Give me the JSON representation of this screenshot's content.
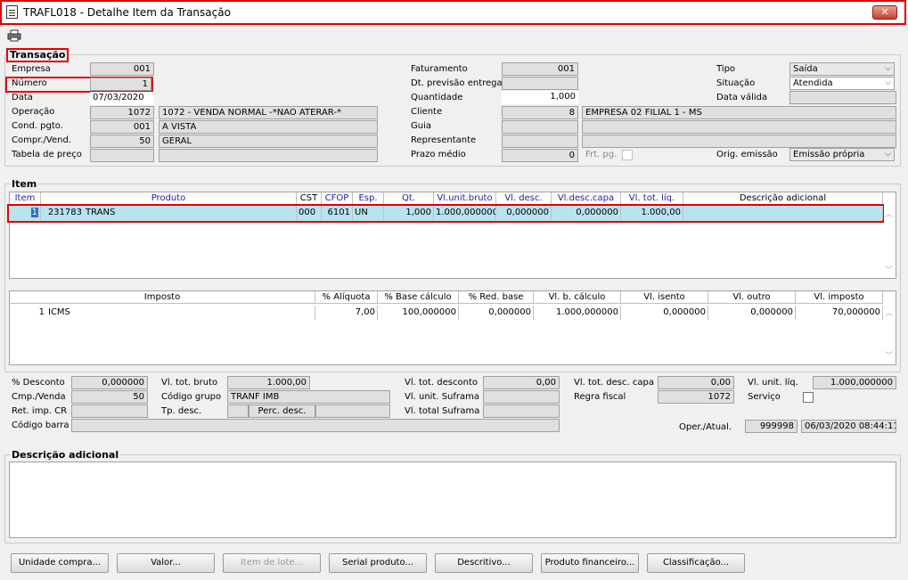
{
  "window": {
    "title": "TRAFL018 - Detalhe Item da Transação",
    "close": "✕"
  },
  "transacao": {
    "title": "Transação",
    "empresa": {
      "label": "Empresa",
      "value": "001"
    },
    "numero": {
      "label": "Número",
      "value": "1"
    },
    "data": {
      "label": "Data",
      "value": "07/03/2020"
    },
    "operacao": {
      "label": "Operação",
      "code": "1072",
      "desc": "1072 - VENDA NORMAL -*NAO ATERAR-*"
    },
    "cond_pgto": {
      "label": "Cond. pgto.",
      "code": "001",
      "desc": "A VISTA"
    },
    "compr_vend": {
      "label": "Compr./Vend.",
      "code": "50",
      "desc": "GERAL"
    },
    "tabela_preco": {
      "label": "Tabela de preço",
      "code": "",
      "desc": ""
    },
    "faturamento": {
      "label": "Faturamento",
      "value": "001"
    },
    "dt_previsao": {
      "label": "Dt. previsão entrega",
      "value": ""
    },
    "quantidade": {
      "label": "Quantidade",
      "value": "1,000"
    },
    "cliente": {
      "label": "Cliente",
      "code": "8",
      "desc": "EMPRESA 02 FILIAL 1 - MS"
    },
    "guia": {
      "label": "Guia",
      "value": ""
    },
    "representante": {
      "label": "Representante",
      "value": ""
    },
    "prazo_medio": {
      "label": "Prazo médio",
      "value": "0"
    },
    "frt_pg": {
      "label": "Frt. pg."
    },
    "tipo": {
      "label": "Tipo",
      "value": "Saída"
    },
    "situacao": {
      "label": "Situação",
      "value": "Atendida"
    },
    "data_valida": {
      "label": "Data válida",
      "value": ""
    },
    "orig_emissao": {
      "label": "Orig. emissão",
      "value": "Emissão própria"
    }
  },
  "item": {
    "title": "Item",
    "headers": [
      "Item",
      "Produto",
      "CST",
      "CFOP",
      "Esp.",
      "Qt.",
      "Vl.unit.bruto",
      "Vl. desc.",
      "Vl.desc.capa",
      "Vl. tot. líq.",
      "Descrição adicional"
    ],
    "rows": [
      {
        "item": "1",
        "code": "231783",
        "produto": "TRANS",
        "cst": "000",
        "cfop": "6101",
        "esp": "UN",
        "qt": "1,000",
        "vl_unit": "1.000,000000",
        "vl_desc": "0,000000",
        "vl_desc_capa": "0,000000",
        "vl_tot": "1.000,00",
        "desc": ""
      }
    ]
  },
  "imposto": {
    "headers": [
      "Imposto",
      "% Alíquota",
      "% Base cálculo",
      "% Red. base",
      "Vl. b. cálculo",
      "Vl. isento",
      "Vl. outro",
      "Vl. imposto"
    ],
    "rows": [
      {
        "num": "1",
        "imposto": "ICMS",
        "aliquota": "7,00",
        "base": "100,000000",
        "red": "0,000000",
        "b_calc": "1.000,000000",
        "isento": "0,000000",
        "outro": "0,000000",
        "vl": "70,000000"
      }
    ]
  },
  "totais": {
    "desconto": {
      "label": "% Desconto",
      "value": "0,000000"
    },
    "cmp_venda": {
      "label": "Cmp./Venda",
      "value": "50"
    },
    "ret_imp": {
      "label": "Ret. imp. CR",
      "value": ""
    },
    "codigo_barra": {
      "label": "Código barra",
      "value": ""
    },
    "vl_tot_bruto": {
      "label": "Vl. tot. bruto",
      "value": "1.000,00"
    },
    "codigo_grupo": {
      "label": "Código grupo",
      "value": "TRANF IMB"
    },
    "tp_desc": {
      "label": "Tp. desc.",
      "value": ""
    },
    "perc_desc": {
      "label": "Perc. desc.",
      "value": ""
    },
    "vl_tot_desconto": {
      "label": "Vl. tot. desconto",
      "value": "0,00"
    },
    "vl_unit_suframa": {
      "label": "Vl. unit. Suframa",
      "value": ""
    },
    "vl_total_suframa": {
      "label": "Vl. total Suframa",
      "value": ""
    },
    "vl_tot_desc_capa": {
      "label": "Vl. tot. desc. capa",
      "value": "0,00"
    },
    "regra_fiscal": {
      "label": "Regra fiscal",
      "value": "1072"
    },
    "vl_unit_liq": {
      "label": "Vl. unit. líq.",
      "value": "1.000,000000"
    },
    "servico": {
      "label": "Serviço"
    },
    "oper_atual": {
      "label": "Oper./Atual.",
      "user": "999998",
      "datetime": "06/03/2020 08:44:11"
    }
  },
  "descricao": {
    "title": "Descrição adicional",
    "value": ""
  },
  "buttons": {
    "unidade": "Unidade compra...",
    "valor": "Valor...",
    "lote": "Item de lote...",
    "serial": "Serial produto...",
    "descritivo": "Descritivo...",
    "financeiro": "Produto financeiro...",
    "classificacao": "Classificação..."
  }
}
